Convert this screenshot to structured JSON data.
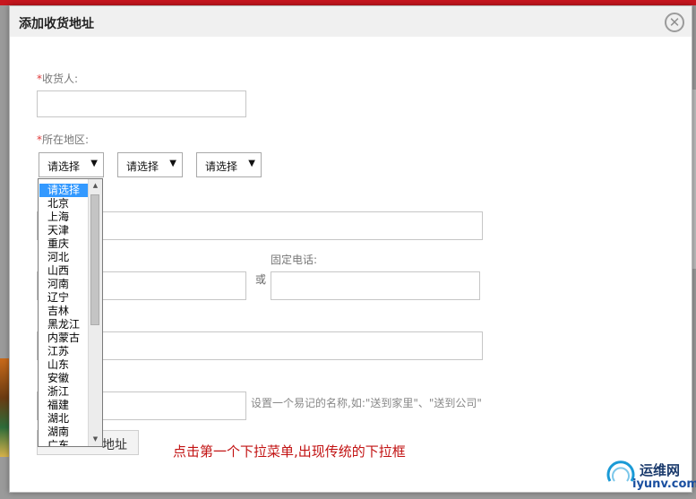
{
  "dialog": {
    "title": "添加收货地址",
    "close_glyph": "✕"
  },
  "form": {
    "receiver": {
      "required_mark": "*",
      "label": "收货人:",
      "value": ""
    },
    "region": {
      "required_mark": "*",
      "label": "所在地区:",
      "selects": [
        {
          "value": "请选择",
          "expanded": true
        },
        {
          "value": "请选择",
          "expanded": false
        },
        {
          "value": "请选择",
          "expanded": false
        }
      ],
      "arrow_glyph": "▼"
    },
    "address": {
      "value": ""
    },
    "mobile": {
      "value": ""
    },
    "or_text": "或",
    "phone": {
      "label": "固定电话:",
      "value": ""
    },
    "email": {
      "value": ""
    },
    "alias": {
      "value": "",
      "hint": "设置一个易记的名称,如:\"送到家里\"、\"送到公司\""
    },
    "save_button": {
      "label": "地址"
    }
  },
  "province_dropdown": {
    "selected_index": 0,
    "options": [
      "请选择",
      "北京",
      "上海",
      "天津",
      "重庆",
      "河北",
      "山西",
      "河南",
      "辽宁",
      "吉林",
      "黑龙江",
      "内蒙古",
      "江苏",
      "山东",
      "安徽",
      "浙江",
      "福建",
      "湖北",
      "湖南",
      "广东"
    ],
    "scroll_up_glyph": "▲",
    "scroll_down_glyph": "▼"
  },
  "annotation": "点击第一个下拉菜单,出现传统的下拉框",
  "watermark": {
    "name_cn": "运维网",
    "domain": "iyunv.com"
  },
  "colors": {
    "annotation": "#c21212",
    "required": "#e03a3a",
    "selected_option": "#3399ff"
  }
}
